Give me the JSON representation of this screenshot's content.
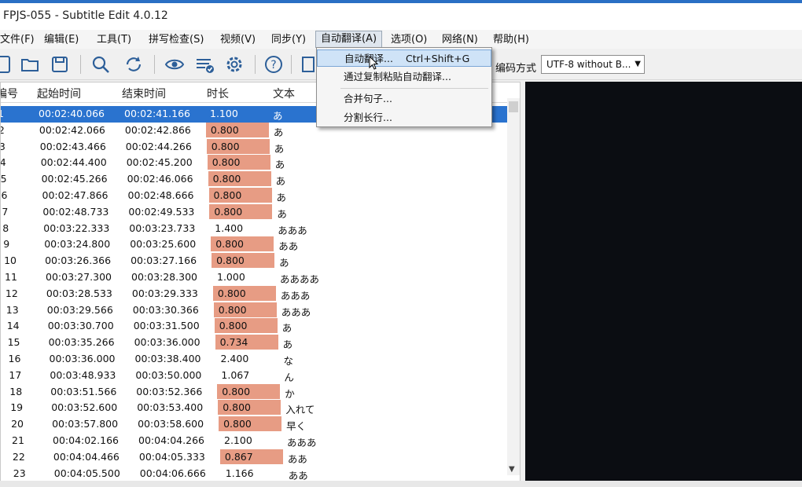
{
  "window": {
    "title": "FPJS-055 - Subtitle Edit 4.0.12"
  },
  "menu": [
    {
      "label": "文件(F)"
    },
    {
      "label": "编辑(E)"
    },
    {
      "label": "工具(T)"
    },
    {
      "label": "拼写检查(S)"
    },
    {
      "label": "视频(V)"
    },
    {
      "label": "同步(Y)"
    },
    {
      "label": "自动翻译(A)"
    },
    {
      "label": "选项(O)"
    },
    {
      "label": "网络(N)"
    },
    {
      "label": "帮助(H)"
    }
  ],
  "toolbar": {
    "encoding_label": "编码方式",
    "encoding_value": "UTF-8 without B...",
    "icons": [
      "new-file-icon",
      "open-folder-icon",
      "save-icon",
      "find-icon",
      "replace-icon",
      "visual-sync-icon",
      "spellcheck-icon",
      "settings-icon",
      "help-icon",
      "layout-icon"
    ]
  },
  "dropdown": {
    "items": [
      {
        "label": "自动翻译...",
        "shortcut": "Ctrl+Shift+G"
      },
      {
        "label": "通过复制粘贴自动翻译...",
        "shortcut": ""
      },
      {
        "label": "合并句子...",
        "shortcut": ""
      },
      {
        "label": "分割长行...",
        "shortcut": ""
      }
    ]
  },
  "grid": {
    "columns": [
      "编号",
      "起始时间",
      "结束时间",
      "时长",
      "文本"
    ],
    "rows": [
      {
        "num": "1",
        "start": "00:02:40.066",
        "end": "00:02:41.166",
        "dur": "1.100",
        "text": "あ",
        "warn": false,
        "selected": true
      },
      {
        "num": "2",
        "start": "00:02:42.066",
        "end": "00:02:42.866",
        "dur": "0.800",
        "text": "あ",
        "warn": true
      },
      {
        "num": "3",
        "start": "00:02:43.466",
        "end": "00:02:44.266",
        "dur": "0.800",
        "text": "あ",
        "warn": true
      },
      {
        "num": "4",
        "start": "00:02:44.400",
        "end": "00:02:45.200",
        "dur": "0.800",
        "text": "あ",
        "warn": true
      },
      {
        "num": "5",
        "start": "00:02:45.266",
        "end": "00:02:46.066",
        "dur": "0.800",
        "text": "あ",
        "warn": true
      },
      {
        "num": "6",
        "start": "00:02:47.866",
        "end": "00:02:48.666",
        "dur": "0.800",
        "text": "あ",
        "warn": true
      },
      {
        "num": "7",
        "start": "00:02:48.733",
        "end": "00:02:49.533",
        "dur": "0.800",
        "text": "あ",
        "warn": true
      },
      {
        "num": "8",
        "start": "00:03:22.333",
        "end": "00:03:23.733",
        "dur": "1.400",
        "text": "あああ",
        "warn": false
      },
      {
        "num": "9",
        "start": "00:03:24.800",
        "end": "00:03:25.600",
        "dur": "0.800",
        "text": "ああ",
        "warn": true
      },
      {
        "num": "10",
        "start": "00:03:26.366",
        "end": "00:03:27.166",
        "dur": "0.800",
        "text": "あ",
        "warn": true
      },
      {
        "num": "11",
        "start": "00:03:27.300",
        "end": "00:03:28.300",
        "dur": "1.000",
        "text": "ああああ",
        "warn": false
      },
      {
        "num": "12",
        "start": "00:03:28.533",
        "end": "00:03:29.333",
        "dur": "0.800",
        "text": "あああ",
        "warn": true
      },
      {
        "num": "13",
        "start": "00:03:29.566",
        "end": "00:03:30.366",
        "dur": "0.800",
        "text": "あああ",
        "warn": true
      },
      {
        "num": "14",
        "start": "00:03:30.700",
        "end": "00:03:31.500",
        "dur": "0.800",
        "text": "あ",
        "warn": true
      },
      {
        "num": "15",
        "start": "00:03:35.266",
        "end": "00:03:36.000",
        "dur": "0.734",
        "text": "あ",
        "warn": true
      },
      {
        "num": "16",
        "start": "00:03:36.000",
        "end": "00:03:38.400",
        "dur": "2.400",
        "text": "な",
        "warn": false
      },
      {
        "num": "17",
        "start": "00:03:48.933",
        "end": "00:03:50.000",
        "dur": "1.067",
        "text": "ん",
        "warn": false
      },
      {
        "num": "18",
        "start": "00:03:51.566",
        "end": "00:03:52.366",
        "dur": "0.800",
        "text": "か",
        "warn": true
      },
      {
        "num": "19",
        "start": "00:03:52.600",
        "end": "00:03:53.400",
        "dur": "0.800",
        "text": "入れて",
        "warn": true
      },
      {
        "num": "20",
        "start": "00:03:57.800",
        "end": "00:03:58.600",
        "dur": "0.800",
        "text": "早く",
        "warn": true
      },
      {
        "num": "21",
        "start": "00:04:02.166",
        "end": "00:04:04.266",
        "dur": "2.100",
        "text": "あああ",
        "warn": false
      },
      {
        "num": "22",
        "start": "00:04:04.466",
        "end": "00:04:05.333",
        "dur": "0.867",
        "text": "ああ",
        "warn": true
      },
      {
        "num": "23",
        "start": "00:04:05.500",
        "end": "00:04:06.666",
        "dur": "1.166",
        "text": "ああ",
        "warn": false
      }
    ]
  },
  "colors": {
    "selection": "#2a73cf",
    "short_duration": "#e79c84",
    "titlebar_accent": "#2a6fc4"
  }
}
